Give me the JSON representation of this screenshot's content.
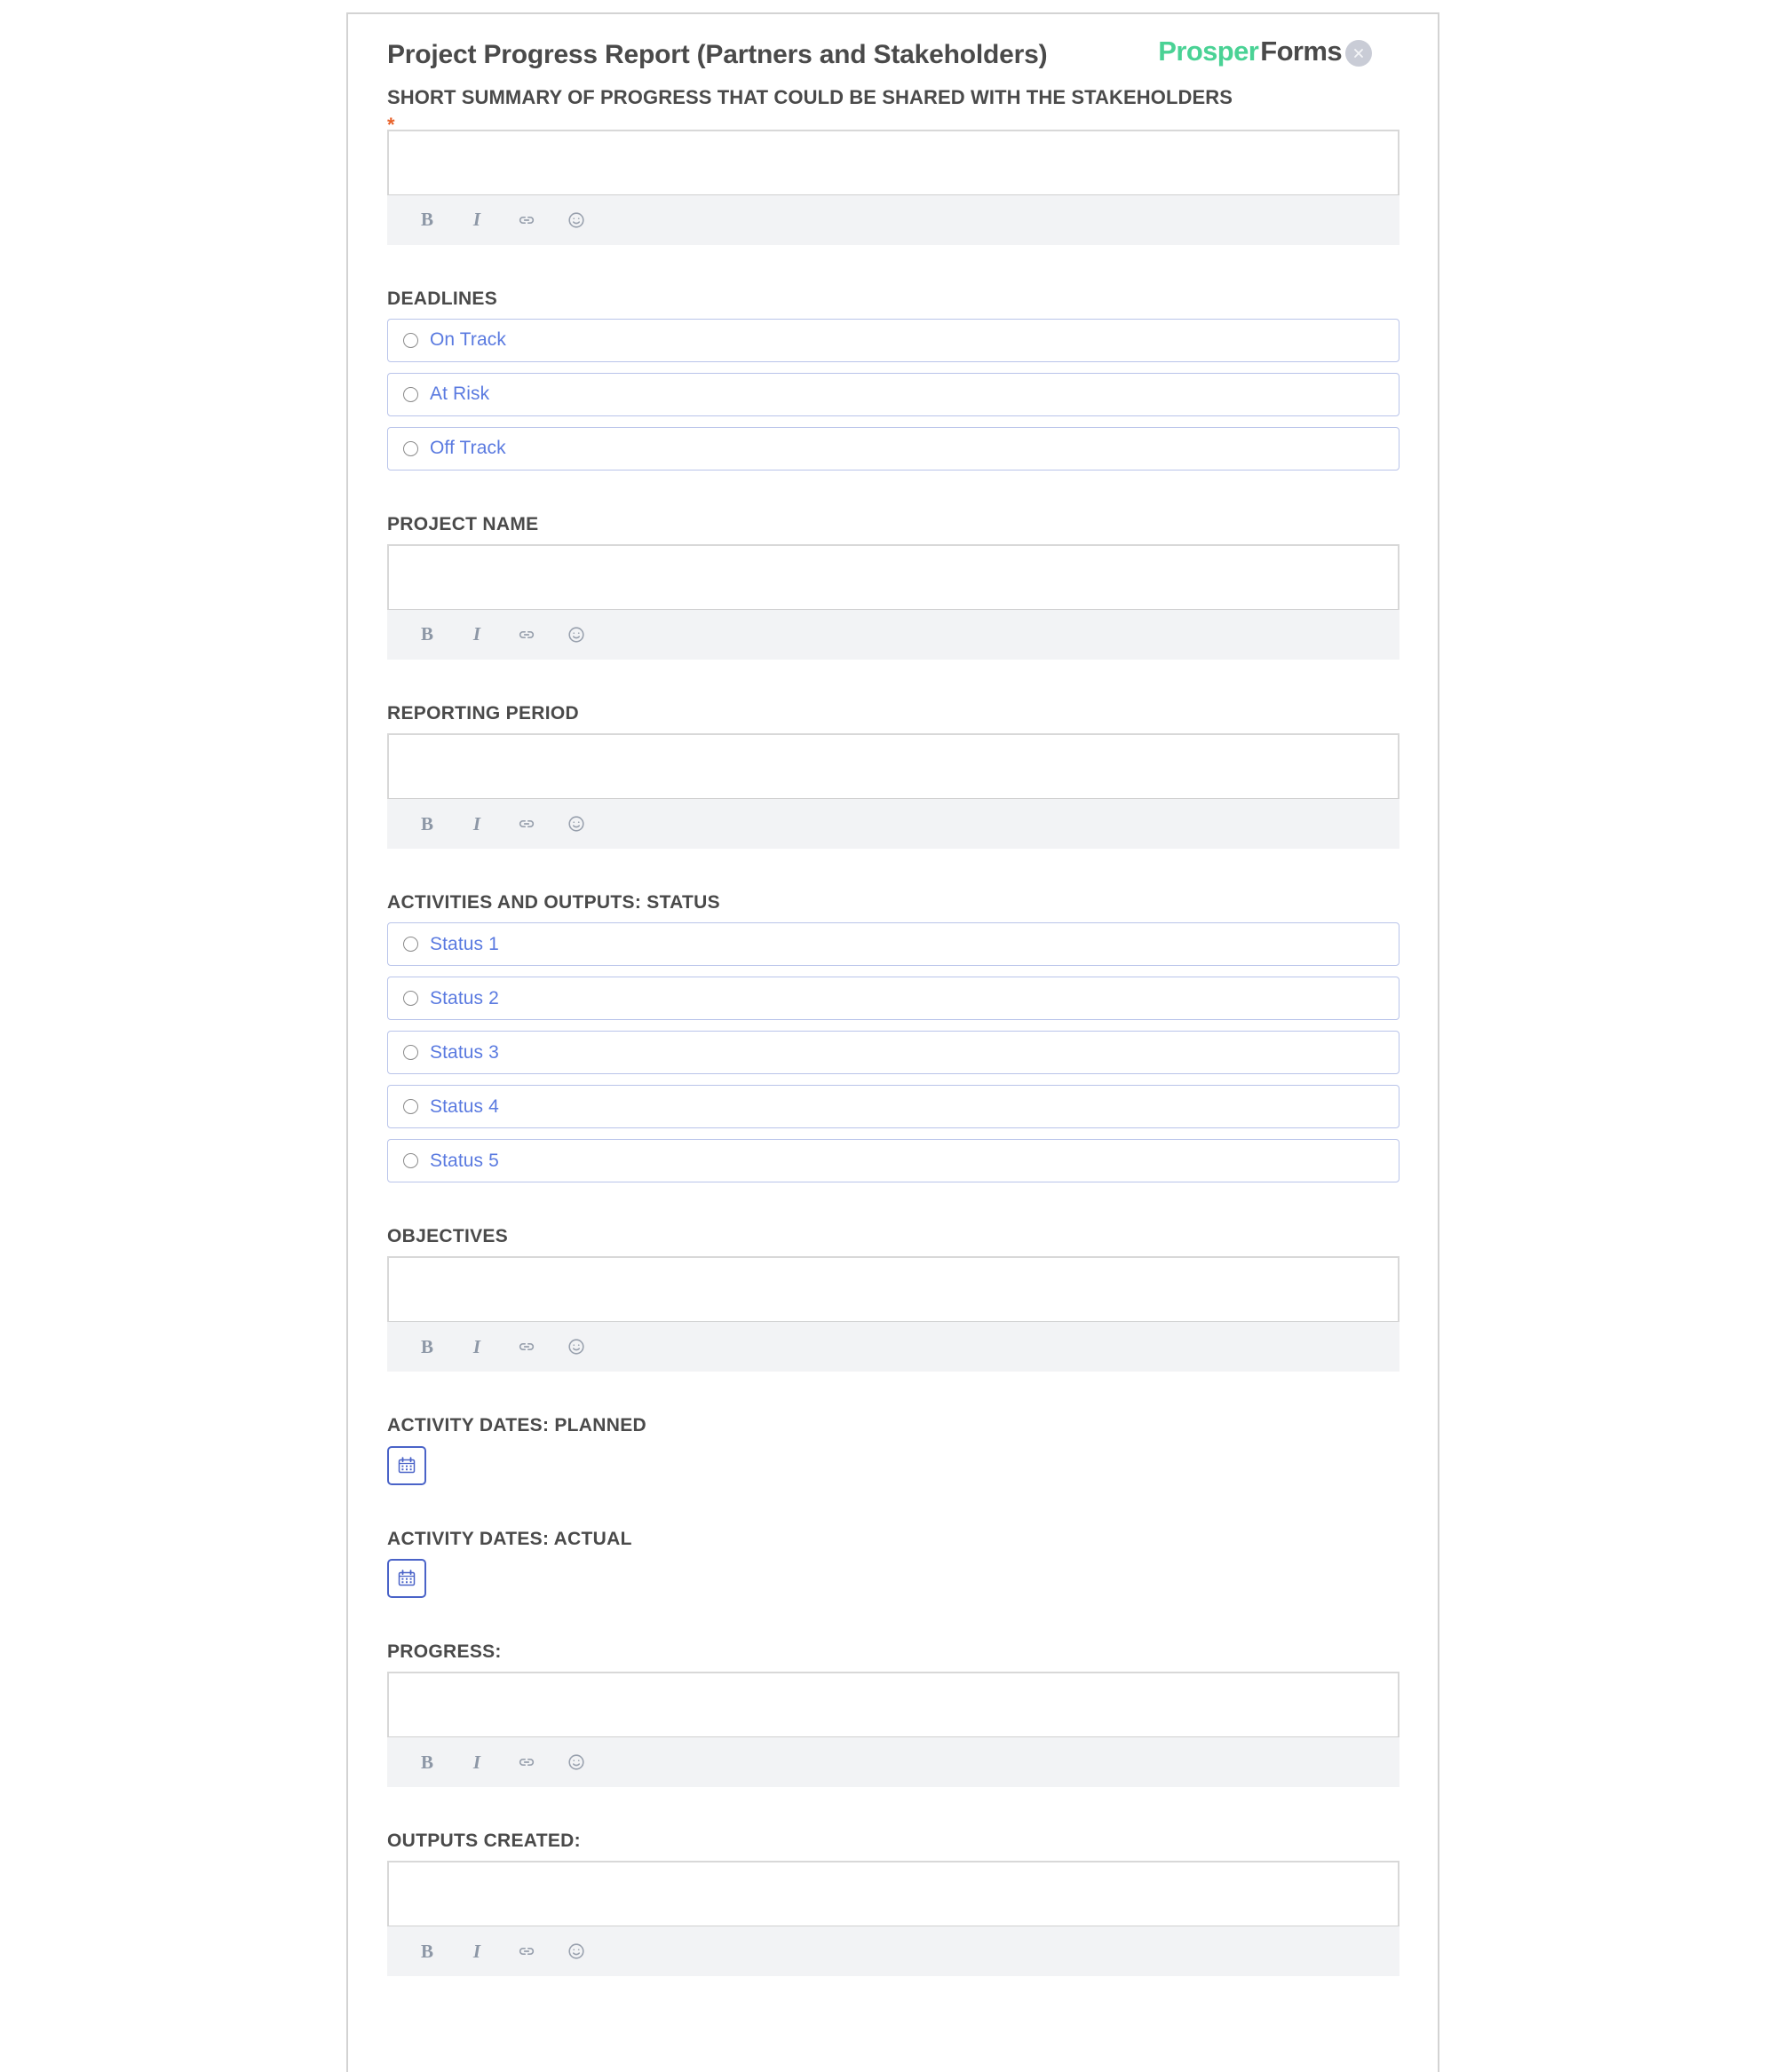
{
  "header": {
    "title": "Project Progress Report (Partners and Stakeholders)",
    "subtitle": "SHORT SUMMARY OF PROGRESS THAT COULD BE SHARED WITH THE STAKEHOLDERS",
    "required_marker": "*",
    "brand_first": "Prosper",
    "brand_second": "Forms",
    "close_icon": "close-icon"
  },
  "colors": {
    "brand_green": "#4ad295",
    "brand_dark": "#4a4a4a",
    "radio_blue": "#5a7ae0",
    "radio_border": "#b9c4ea",
    "required_orange": "#e8622a",
    "date_button_blue": "#4a63c8",
    "toolbar_bg": "#f2f3f5"
  },
  "editor_toolbar": {
    "bold_label": "B",
    "italic_label": "I",
    "bold_name": "bold-icon",
    "italic_name": "italic-icon",
    "link_name": "link-icon",
    "emoji_name": "emoji-icon"
  },
  "fields": {
    "summary": {
      "label": "",
      "value": "",
      "type": "richtext"
    },
    "deadlines": {
      "label": "DEADLINES",
      "type": "radio",
      "options": [
        "On Track",
        "At Risk",
        "Off Track"
      ]
    },
    "project_name": {
      "label": "PROJECT NAME",
      "value": "",
      "type": "richtext"
    },
    "reporting_period": {
      "label": "REPORTING PERIOD",
      "value": "",
      "type": "richtext"
    },
    "activities_status": {
      "label": "ACTIVITIES AND OUTPUTS: STATUS",
      "type": "radio",
      "options": [
        "Status 1",
        "Status 2",
        "Status 3",
        "Status 4",
        "Status 5"
      ]
    },
    "objectives": {
      "label": "OBJECTIVES",
      "value": "",
      "type": "richtext"
    },
    "activity_dates_planned": {
      "label": "ACTIVITY DATES: PLANNED",
      "type": "date",
      "value": ""
    },
    "activity_dates_actual": {
      "label": "ACTIVITY DATES: ACTUAL",
      "type": "date",
      "value": ""
    },
    "progress": {
      "label": "PROGRESS:",
      "value": "",
      "type": "richtext"
    },
    "outputs_created": {
      "label": "OUTPUTS CREATED:",
      "value": "",
      "type": "richtext"
    }
  }
}
